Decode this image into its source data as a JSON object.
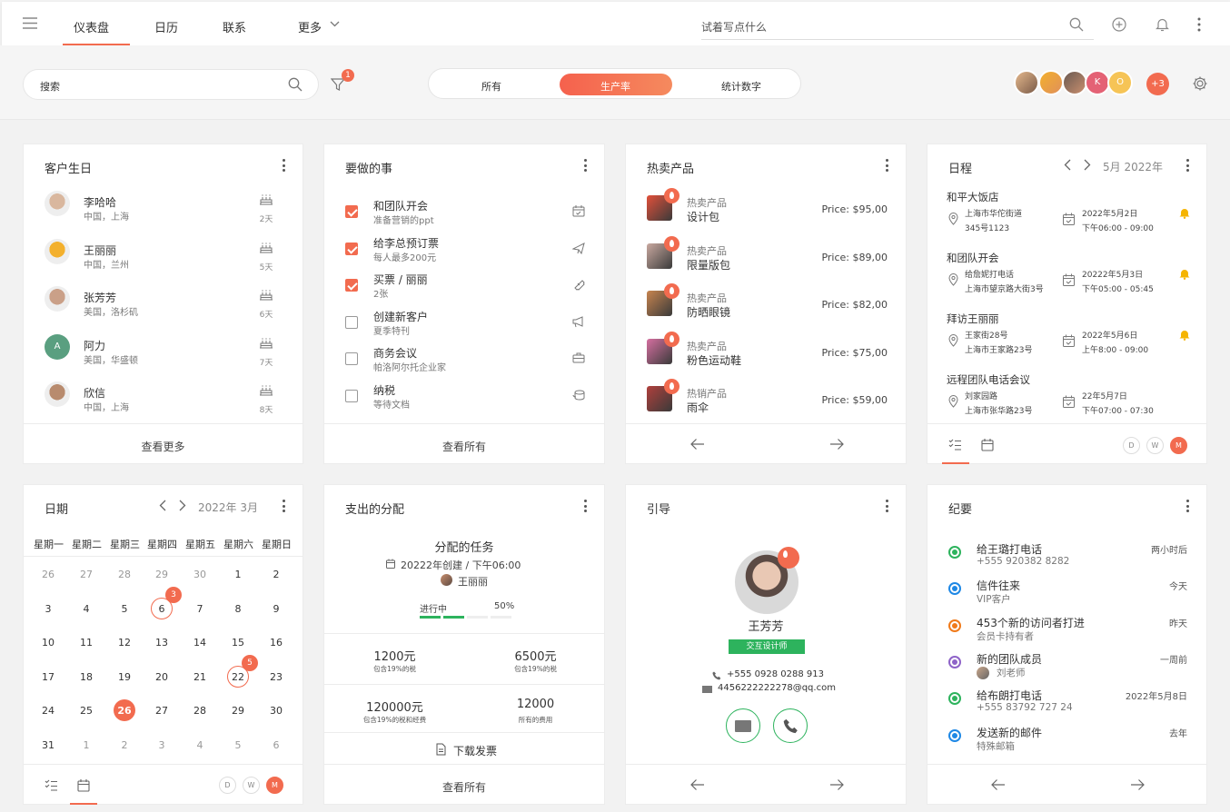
{
  "nav": {
    "tabs": [
      "仪表盘",
      "日历",
      "联系",
      "更多"
    ],
    "search_placeholder": "试着写点什么"
  },
  "filter": {
    "search_label": "搜索",
    "filter_count": "1",
    "segments": [
      "所有",
      "生产率",
      "统计数字"
    ],
    "more_users": "+3",
    "avatar_letters": [
      "K",
      "O"
    ]
  },
  "birthdays": {
    "title": "客户生日",
    "footer": "查看更多",
    "items": [
      {
        "name": "李哈哈",
        "place": "中国，上海",
        "days": "2天"
      },
      {
        "name": "王丽丽",
        "place": "中国，兰州",
        "days": "5天"
      },
      {
        "name": "张芳芳",
        "place": "美国，洛杉矶",
        "days": "6天"
      },
      {
        "name": "阿力",
        "place": "美国，华盛顿",
        "days": "7天",
        "initial": "A"
      },
      {
        "name": "欣信",
        "place": "中国，上海",
        "days": "8天"
      }
    ]
  },
  "todo": {
    "title": "要做的事",
    "footer": "查看所有",
    "items": [
      {
        "title": "和团队开会",
        "sub": "准备营销的ppt",
        "done": true,
        "icon": "calendar-check-icon"
      },
      {
        "title": "给李总预订票",
        "sub": "每人最多200元",
        "done": true,
        "icon": "plane-icon"
      },
      {
        "title": "买票 / 丽丽",
        "sub": "2张",
        "done": true,
        "icon": "ticket-icon"
      },
      {
        "title": "创建新客户",
        "sub": "夏季特刊",
        "done": false,
        "icon": "megaphone-icon"
      },
      {
        "title": "商务会议",
        "sub": "帕洛阿尔托企业家",
        "done": false,
        "icon": "briefcase-icon"
      },
      {
        "title": "纳税",
        "sub": "等待文档",
        "done": false,
        "icon": "coins-icon"
      }
    ]
  },
  "hot": {
    "title": "热卖产品",
    "items": [
      {
        "cat": "热卖产品",
        "name": "设计包",
        "price": "Price: $95,00",
        "color": "#e2503a"
      },
      {
        "cat": "热卖产品",
        "name": "限量版包",
        "price": "Price: $89,00",
        "color": "#c9a9a0"
      },
      {
        "cat": "热卖产品",
        "name": "防晒眼镜",
        "price": "Price: $82,00",
        "color": "#c7844f"
      },
      {
        "cat": "热卖产品",
        "name": "粉色运动鞋",
        "price": "Price: $75,00",
        "color": "#d56fa0"
      },
      {
        "cat": "热销产品",
        "name": "雨伞",
        "price": "Price: $59,00",
        "color": "#b0403c"
      }
    ]
  },
  "schedule": {
    "title": "日程",
    "month": "5月 2022年",
    "items": [
      {
        "title": "和平大饭店",
        "addr1": "上海市华佗街道",
        "addr2": "345号1123",
        "date": "2022年5月2日",
        "time": "下午06:00 - 09:00"
      },
      {
        "title": "和团队开会",
        "addr1": "给詹妮打电话",
        "addr2": "上海市望京路大街3号",
        "date": "20222年5月3日",
        "time": "下午05:00 - 05:45"
      },
      {
        "title": "拜访王丽丽",
        "addr1": "王家街28号",
        "addr2": "上海市王家路23号",
        "date": "2022年5月6日",
        "time": "上午8:00 - 09:00"
      },
      {
        "title": "远程团队电话会议",
        "addr1": "刘家园路",
        "addr2": "上海市张华路23号",
        "date": "22年5月7日",
        "time": "下午07:00 - 07:30"
      }
    ],
    "views": [
      "D",
      "W",
      "M"
    ]
  },
  "calendar": {
    "title": "日期",
    "month": "2022年 3月",
    "weekdays": [
      "星期一",
      "星期二",
      "星期三",
      "星期四",
      "星期五",
      "星期六",
      "星期日"
    ],
    "weeks": [
      [
        "26",
        "27",
        "28",
        "29",
        "30",
        "1",
        "2"
      ],
      [
        "3",
        "4",
        "5",
        "6",
        "7",
        "8",
        "9"
      ],
      [
        "10",
        "11",
        "12",
        "13",
        "14",
        "15",
        "16"
      ],
      [
        "17",
        "18",
        "19",
        "20",
        "21",
        "22",
        "23"
      ],
      [
        "24",
        "25",
        "26",
        "27",
        "28",
        "29",
        "30"
      ],
      [
        "31",
        "1",
        "2",
        "3",
        "4",
        "5",
        "6"
      ]
    ],
    "badges": {
      "6": "3",
      "22": "5"
    },
    "views": [
      "D",
      "W",
      "M"
    ]
  },
  "expense": {
    "title": "支出的分配",
    "task_title": "分配的任务",
    "created": "20222年创建 / 下午06:00",
    "assignee": "王丽丽",
    "status": "进行中",
    "progress_label": "50%",
    "progress": 0.5,
    "cells": [
      {
        "value": "1200元",
        "note": "包含19%的税"
      },
      {
        "value": "6500元",
        "note": "包含19%的税"
      },
      {
        "value": "120000元",
        "note": "包含19%的税和经费"
      },
      {
        "value": "12000",
        "note": "所有的费用"
      }
    ],
    "download": "下载发票",
    "footer": "查看所有"
  },
  "lead": {
    "title": "引导",
    "name": "王芳芳",
    "role": "交互设计师",
    "phone": "+555 0928 0288 913",
    "email": "4456222222278@qq.com"
  },
  "notes": {
    "title": "纪要",
    "items": [
      {
        "title": "给王璐打电话",
        "sub": "+555 920382 8282",
        "time": "两小时后",
        "color": "#2db35d"
      },
      {
        "title": "信件往来",
        "sub": "VIP客户",
        "time": "今天",
        "color": "#1e88e5"
      },
      {
        "title": "453个新的访问者打进",
        "sub": "会员卡持有者",
        "time": "昨天",
        "color": "#f07a1a"
      },
      {
        "title": "新的团队成员",
        "sub": "刘老师",
        "time": "一周前",
        "color": "#8e63c8"
      },
      {
        "title": "给布朗打电话",
        "sub": "+555 83792 727 24",
        "time": "2022年5月8日",
        "color": "#2db35d"
      },
      {
        "title": "发送新的邮件",
        "sub": "特殊邮箱",
        "time": "去年",
        "color": "#1e88e5"
      }
    ]
  },
  "colors": {
    "accent": "#f26b4f",
    "green": "#2db35d"
  }
}
